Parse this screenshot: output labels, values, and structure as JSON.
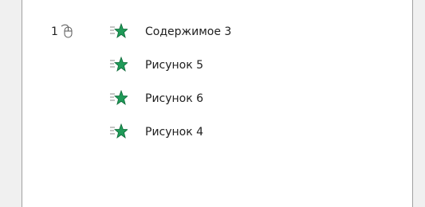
{
  "animation_list": {
    "items": [
      {
        "order": "1",
        "trigger_icon": "mouse-click-icon",
        "effect_icon": "entrance-star-icon",
        "label": "Содержимое 3"
      },
      {
        "order": "",
        "trigger_icon": "",
        "effect_icon": "entrance-star-icon",
        "label": "Рисунок 5"
      },
      {
        "order": "",
        "trigger_icon": "",
        "effect_icon": "entrance-star-icon",
        "label": "Рисунок 6"
      },
      {
        "order": "",
        "trigger_icon": "",
        "effect_icon": "entrance-star-icon",
        "label": "Рисунок 4"
      }
    ]
  },
  "colors": {
    "star_fill": "#1f9a58",
    "star_dark": "#0f6b3a",
    "pane_bg": "#ffffff",
    "frame_bg": "#f0f0f0"
  }
}
